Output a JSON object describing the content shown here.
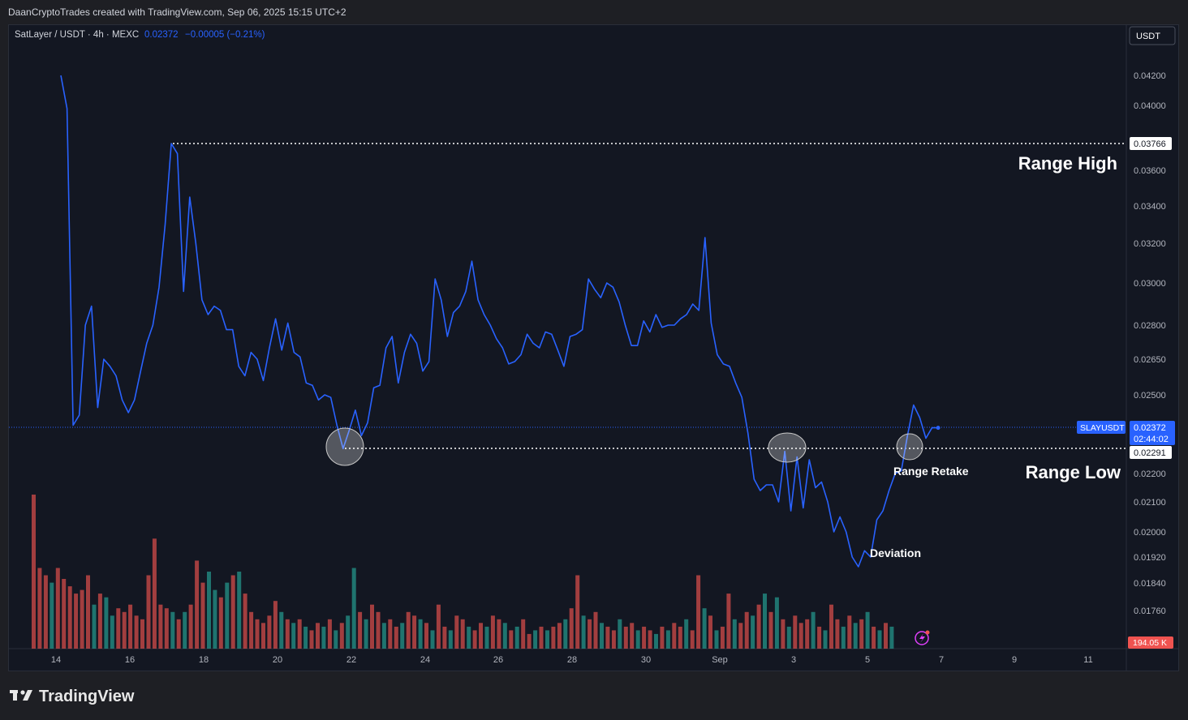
{
  "header": {
    "caption": "DaanCryptoTrades created with TradingView.com, Sep 06, 2025 15:15 UTC+2"
  },
  "legend": {
    "symbol_info": "SatLayer / USDT · 4h · MEXC",
    "price": "0.02372",
    "change": "−0.00005 (−0.21%)"
  },
  "currency_button": "USDT",
  "brand": {
    "name": "TradingView"
  },
  "colors": {
    "line": "#2962ff",
    "vol_up": "#26a69a",
    "vol_down": "#ef5350",
    "background": "#131722"
  },
  "chart_data": {
    "type": "line",
    "title": "",
    "xlabel": "",
    "ylabel": "",
    "x_start_label": "Aug 13 20:00",
    "x_step_hours": 4,
    "y_ticks": [
      "0.04200",
      "0.04000",
      "0.03600",
      "0.03400",
      "0.03200",
      "0.03000",
      "0.02800",
      "0.02650",
      "0.02500",
      "0.02200",
      "0.02100",
      "0.02000",
      "0.01920",
      "0.01840",
      "0.01760"
    ],
    "x_ticks": [
      {
        "label": "14",
        "x": "Aug 14"
      },
      {
        "label": "16",
        "x": "Aug 16"
      },
      {
        "label": "18",
        "x": "Aug 18"
      },
      {
        "label": "20",
        "x": "Aug 20"
      },
      {
        "label": "22",
        "x": "Aug 22"
      },
      {
        "label": "24",
        "x": "Aug 24"
      },
      {
        "label": "26",
        "x": "Aug 26"
      },
      {
        "label": "28",
        "x": "Aug 28"
      },
      {
        "label": "30",
        "x": "Aug 30"
      },
      {
        "label": "Sep",
        "x": "Sep 1"
      },
      {
        "label": "3",
        "x": "Sep 3"
      },
      {
        "label": "5",
        "x": "Sep 5"
      },
      {
        "label": "7",
        "x": "Sep 7"
      },
      {
        "label": "9",
        "x": "Sep 9"
      },
      {
        "label": "11",
        "x": "Sep 11"
      }
    ],
    "series": [
      {
        "values": [
          0.042,
          0.0398,
          0.0238,
          0.0242,
          0.028,
          0.0289,
          0.0245,
          0.0265,
          0.0262,
          0.0258,
          0.0248,
          0.0243,
          0.0248,
          0.026,
          0.0272,
          0.028,
          0.0298,
          0.033,
          0.0376,
          0.037,
          0.0296,
          0.0345,
          0.032,
          0.0292,
          0.0285,
          0.0289,
          0.0287,
          0.0278,
          0.0278,
          0.0262,
          0.0258,
          0.0268,
          0.0265,
          0.0256,
          0.027,
          0.0283,
          0.0269,
          0.0281,
          0.0268,
          0.0266,
          0.0255,
          0.0254,
          0.0248,
          0.025,
          0.0249,
          0.0238,
          0.0229,
          0.0236,
          0.0244,
          0.0234,
          0.0239,
          0.0253,
          0.0254,
          0.027,
          0.0275,
          0.0255,
          0.0268,
          0.0276,
          0.0272,
          0.026,
          0.0264,
          0.0302,
          0.0292,
          0.0275,
          0.0286,
          0.0289,
          0.0296,
          0.0311,
          0.0292,
          0.0285,
          0.028,
          0.0274,
          0.027,
          0.0263,
          0.0264,
          0.0267,
          0.0276,
          0.0272,
          0.027,
          0.0277,
          0.0276,
          0.0269,
          0.0262,
          0.0275,
          0.0276,
          0.0278,
          0.0302,
          0.0297,
          0.0293,
          0.03,
          0.0298,
          0.0291,
          0.028,
          0.0271,
          0.0271,
          0.0282,
          0.0277,
          0.0285,
          0.0279,
          0.028,
          0.028,
          0.0283,
          0.0285,
          0.029,
          0.0287,
          0.0323,
          0.0281,
          0.0267,
          0.0263,
          0.0262,
          0.0255,
          0.0249,
          0.0235,
          0.0218,
          0.0214,
          0.0216,
          0.0216,
          0.021,
          0.0228,
          0.0207,
          0.0226,
          0.0208,
          0.0225,
          0.0215,
          0.0217,
          0.021,
          0.02,
          0.0205,
          0.02,
          0.0192,
          0.0189,
          0.0194,
          0.0192,
          0.0204,
          0.0207,
          0.0214,
          0.022,
          0.0221,
          0.0234,
          0.0246,
          0.0241,
          0.0233,
          0.0237,
          0.0237
        ]
      }
    ],
    "volume": {
      "values": [
        42,
        22,
        20,
        18,
        22,
        19,
        17,
        15,
        16,
        20,
        12,
        15,
        14,
        9,
        11,
        10,
        12,
        9,
        8,
        20,
        30,
        12,
        11,
        10,
        8,
        10,
        12,
        24,
        18,
        21,
        16,
        14,
        18,
        20,
        21,
        15,
        10,
        8,
        7,
        9,
        13,
        10,
        8,
        7,
        8,
        6,
        5,
        7,
        6,
        8,
        5,
        7,
        9,
        22,
        10,
        8,
        12,
        10,
        7,
        8,
        6,
        7,
        10,
        9,
        8,
        7,
        5,
        12,
        6,
        5,
        9,
        8,
        6,
        5,
        7,
        6,
        9,
        8,
        7,
        5,
        6,
        8,
        4,
        5,
        6,
        5,
        6,
        7,
        8,
        11,
        20,
        9,
        8,
        10,
        7,
        6,
        5,
        8,
        6,
        7,
        5,
        6,
        5,
        4,
        6,
        5,
        7,
        6,
        8,
        5,
        20,
        11,
        9,
        5,
        6,
        15,
        8,
        7,
        10,
        9,
        12,
        15,
        10,
        14,
        8,
        6,
        9,
        7,
        8,
        10,
        6,
        5,
        12,
        8,
        6,
        9,
        7,
        8,
        10,
        6,
        5,
        7,
        6
      ],
      "up": [
        false,
        false,
        false,
        true,
        false,
        false,
        false,
        false,
        false,
        false,
        true,
        false,
        true,
        true,
        false,
        false,
        false,
        false,
        false,
        false,
        false,
        false,
        false,
        true,
        false,
        true,
        false,
        false,
        false,
        true,
        true,
        false,
        true,
        false,
        true,
        false,
        false,
        false,
        false,
        false,
        false,
        true,
        false,
        true,
        false,
        true,
        false,
        false,
        true,
        false,
        true,
        false,
        true,
        true,
        false,
        true,
        false,
        false,
        true,
        false,
        false,
        true,
        false,
        false,
        true,
        false,
        true,
        false,
        false,
        true,
        false,
        false,
        true,
        false,
        false,
        true,
        false,
        false,
        true,
        false,
        true,
        false,
        false,
        true,
        false,
        true,
        false,
        false,
        true,
        false,
        false,
        true,
        false,
        false,
        true,
        false,
        false,
        true,
        false,
        false,
        true,
        false,
        false,
        true,
        false,
        true,
        false,
        false,
        true,
        false,
        false,
        true,
        false,
        true,
        false,
        false,
        true,
        false,
        false,
        true,
        false,
        true,
        false,
        true,
        false,
        true,
        false,
        false,
        false,
        true,
        false,
        true,
        false,
        false,
        true,
        false,
        true,
        false,
        true,
        false,
        true,
        false,
        true
      ],
      "last_value": "194.05 K"
    }
  },
  "levels": {
    "range_high_price": "0.03766",
    "range_low_price": "0.02291",
    "current_symbol": "SLAYUSDT",
    "current_price": "0.02372",
    "countdown": "02:44:02"
  },
  "annotations": {
    "range_high": "Range High",
    "range_low": "Range Low",
    "range_retake": "Range Retake",
    "deviation": "Deviation"
  }
}
